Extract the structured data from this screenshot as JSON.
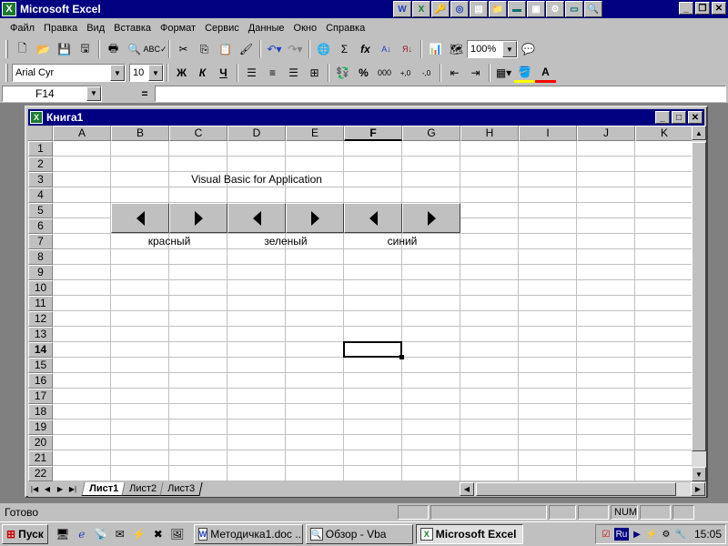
{
  "app": {
    "title": "Microsoft Excel"
  },
  "menu": {
    "items": [
      {
        "label": "Файл"
      },
      {
        "label": "Правка"
      },
      {
        "label": "Вид"
      },
      {
        "label": "Вставка"
      },
      {
        "label": "Формат"
      },
      {
        "label": "Сервис"
      },
      {
        "label": "Данные"
      },
      {
        "label": "Окно"
      },
      {
        "label": "Справка"
      }
    ]
  },
  "toolbar": {
    "zoom": "100%",
    "font_name": "Arial Cyr",
    "font_size": "10",
    "bold_label": "Ж",
    "italic_label": "К",
    "underline_label": "Ч",
    "percent_label": "%",
    "thousands_label": "000",
    "sum_label": "Σ",
    "fx_label": "fx"
  },
  "formula_bar": {
    "name_box": "F14",
    "equals": "=",
    "value": ""
  },
  "workbook": {
    "title": "Книга1",
    "columns": [
      "A",
      "B",
      "C",
      "D",
      "E",
      "F",
      "G",
      "H",
      "I",
      "J",
      "K"
    ],
    "active_column": "F",
    "rows": [
      "1",
      "2",
      "3",
      "4",
      "5",
      "6",
      "7",
      "8",
      "9",
      "10",
      "11",
      "12",
      "13",
      "14",
      "15",
      "16",
      "17",
      "18",
      "19",
      "20",
      "21",
      "22"
    ],
    "active_row": "14",
    "heading": "Visual Basic for Application",
    "labels": {
      "red": "красный",
      "green": "зеленый",
      "blue": "синий"
    },
    "sheets": [
      "Лист1",
      "Лист2",
      "Лист3"
    ],
    "active_sheet": "Лист1"
  },
  "status": {
    "ready": "Готово",
    "num": "NUM"
  },
  "taskbar": {
    "start": "Пуск",
    "tasks": [
      {
        "label": "Методичка1.doc ..."
      },
      {
        "label": "Обзор - Vba"
      },
      {
        "label": "Microsoft Excel"
      }
    ],
    "language": "Ru",
    "time": "15:05"
  }
}
